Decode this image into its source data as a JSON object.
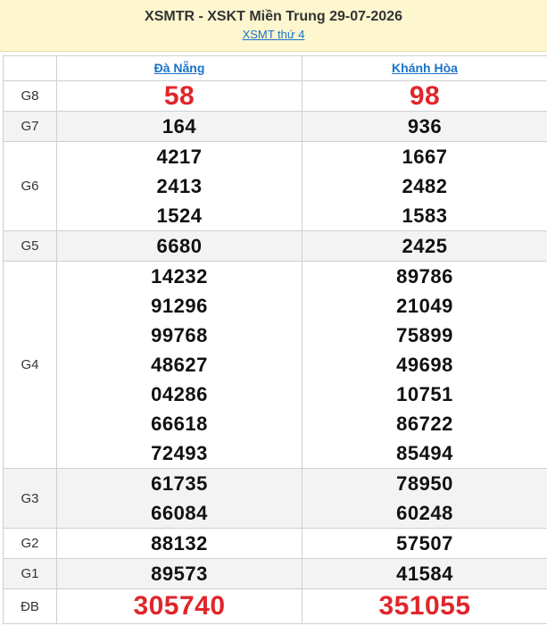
{
  "header": {
    "title": "XSMTR - XSKT Miền Trung 29-07-2026",
    "subtitle_link": "XSMT thứ 4"
  },
  "provinces": [
    "Đà Nẵng",
    "Khánh Hòa"
  ],
  "prizes": [
    {
      "label": "G8",
      "values": [
        [
          "58"
        ],
        [
          "98"
        ]
      ],
      "style": "red",
      "alt": false
    },
    {
      "label": "G7",
      "values": [
        [
          "164"
        ],
        [
          "936"
        ]
      ],
      "style": "normal",
      "alt": true
    },
    {
      "label": "G6",
      "values": [
        [
          "4217",
          "2413",
          "1524"
        ],
        [
          "1667",
          "2482",
          "1583"
        ]
      ],
      "style": "normal",
      "alt": false
    },
    {
      "label": "G5",
      "values": [
        [
          "6680"
        ],
        [
          "2425"
        ]
      ],
      "style": "normal",
      "alt": true
    },
    {
      "label": "G4",
      "values": [
        [
          "14232",
          "91296",
          "99768",
          "48627",
          "04286",
          "66618",
          "72493"
        ],
        [
          "89786",
          "21049",
          "75899",
          "49698",
          "10751",
          "86722",
          "85494"
        ]
      ],
      "style": "normal",
      "alt": false
    },
    {
      "label": "G3",
      "values": [
        [
          "61735",
          "66084"
        ],
        [
          "78950",
          "60248"
        ]
      ],
      "style": "normal",
      "alt": true
    },
    {
      "label": "G2",
      "values": [
        [
          "88132"
        ],
        [
          "57507"
        ]
      ],
      "style": "normal",
      "alt": false
    },
    {
      "label": "G1",
      "values": [
        [
          "89573"
        ],
        [
          "41584"
        ]
      ],
      "style": "normal",
      "alt": true
    },
    {
      "label": "ĐB",
      "values": [
        [
          "305740"
        ],
        [
          "351055"
        ]
      ],
      "style": "special",
      "alt": false
    }
  ],
  "colors": {
    "accent_red": "#e0262b",
    "link_blue": "#1a73c9",
    "header_bg": "#fdf6cf"
  }
}
